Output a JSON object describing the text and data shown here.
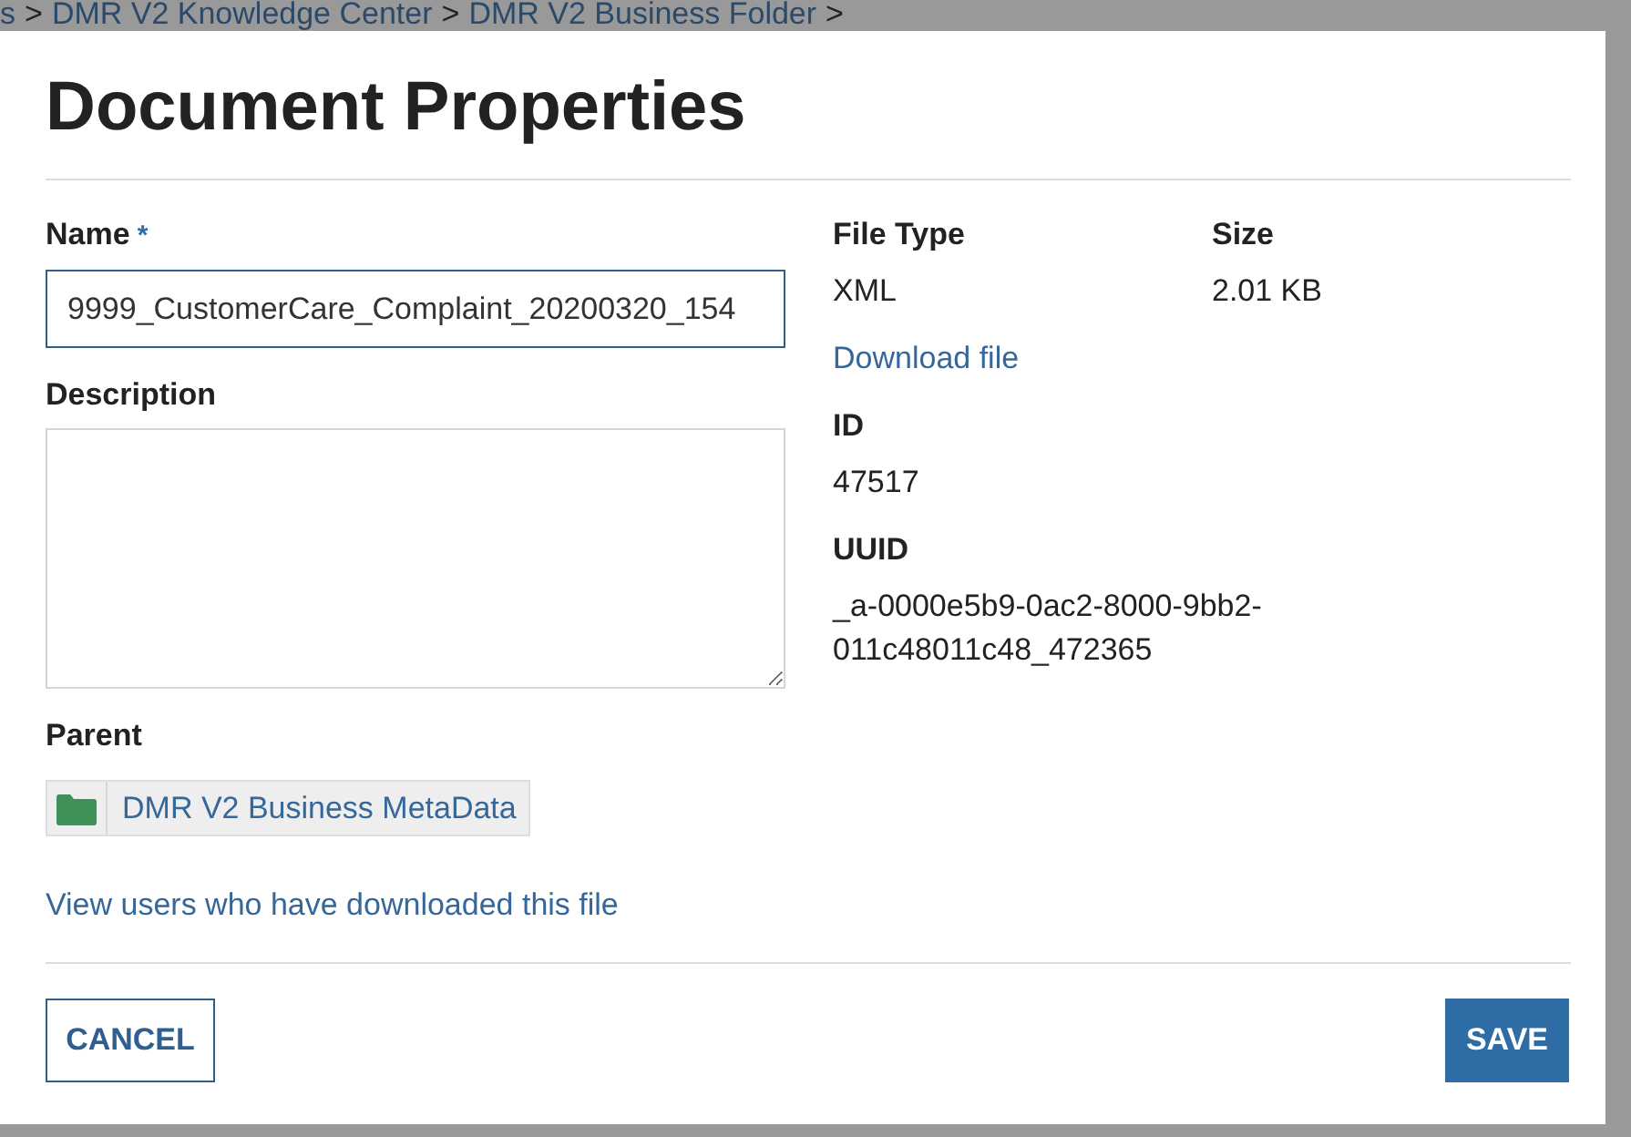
{
  "breadcrumb": [
    {
      "label": "s",
      "separator": ">"
    },
    {
      "label": "DMR V2 Knowledge Center",
      "separator": ">"
    },
    {
      "label": "DMR V2 Business Folder",
      "separator": ">"
    }
  ],
  "dialog": {
    "title": "Document Properties",
    "name": {
      "label": "Name",
      "required_mark": "*",
      "value": "9999_CustomerCare_Complaint_20200320_154",
      "focused": true
    },
    "description": {
      "label": "Description",
      "focused": false
    },
    "parent": {
      "label": "Parent",
      "folder": "DMR V2 Business MetaData"
    },
    "downloads_link": "View users who have downloaded this file",
    "details": [
      {
        "label": "File Type",
        "value": "XML"
      },
      {
        "label": "Size",
        "value": "2.01 KB"
      }
    ],
    "download_link": "Download file",
    "id": {
      "label": "ID",
      "value": "47517"
    },
    "uuid": {
      "label": "UUID",
      "value": "_a-0000e5b9-0ac2-8000-9bb2-011c48011c48_472365"
    },
    "buttons": [
      {
        "label": "CANCEL",
        "kind": "secondary"
      },
      {
        "label": "SAVE",
        "kind": "primary"
      }
    ]
  }
}
